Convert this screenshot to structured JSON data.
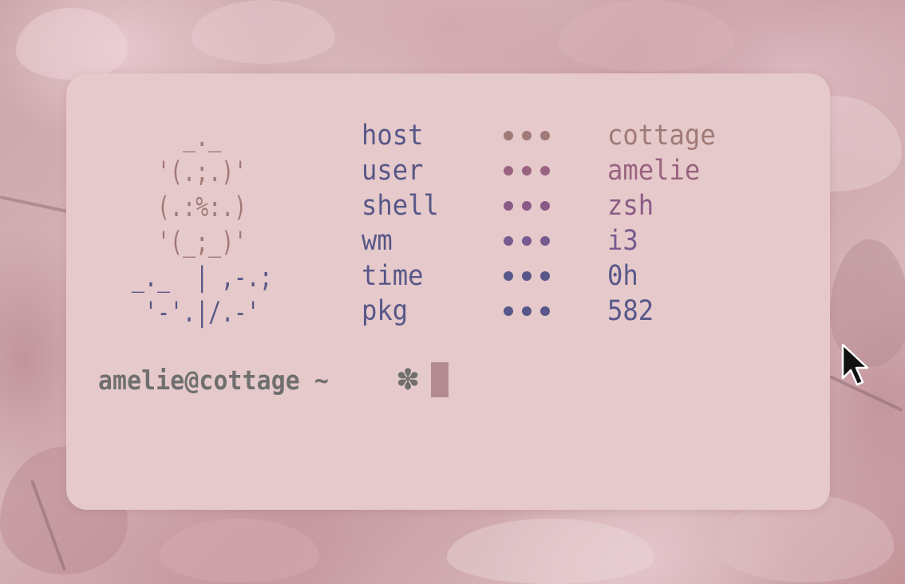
{
  "ascii_art": {
    "tree_lines": [
      "    _._",
      "  '(.;.)'",
      "  (.:%:.)",
      "  '(_;_)'"
    ],
    "ground_lines": [
      "_._  | ,-.;",
      " '-'.|/.-'"
    ]
  },
  "info": [
    {
      "key": "host",
      "value": "cottage",
      "value_color": "#a07a77",
      "dot_color": "#a07a77"
    },
    {
      "key": "user",
      "value": "amelie",
      "value_color": "#9a6380",
      "dot_color": "#9a6380"
    },
    {
      "key": "shell",
      "value": "zsh",
      "value_color": "#8a5a86",
      "dot_color": "#8a5a86"
    },
    {
      "key": "wm",
      "value": "i3",
      "value_color": "#765a90",
      "dot_color": "#765a90"
    },
    {
      "key": "time",
      "value": "0h",
      "value_color": "#575789",
      "dot_color": "#575789"
    },
    {
      "key": "pkg",
      "value": "582",
      "value_color": "#575789",
      "dot_color": "#575789"
    }
  ],
  "prompt": {
    "text": "amelie@cottage ~",
    "symbol": "✽"
  },
  "colors": {
    "terminal_bg": "#e6c9ca",
    "key_color": "#575789",
    "prompt_color": "#6f6f6f",
    "cursor_color": "#b58b93"
  }
}
